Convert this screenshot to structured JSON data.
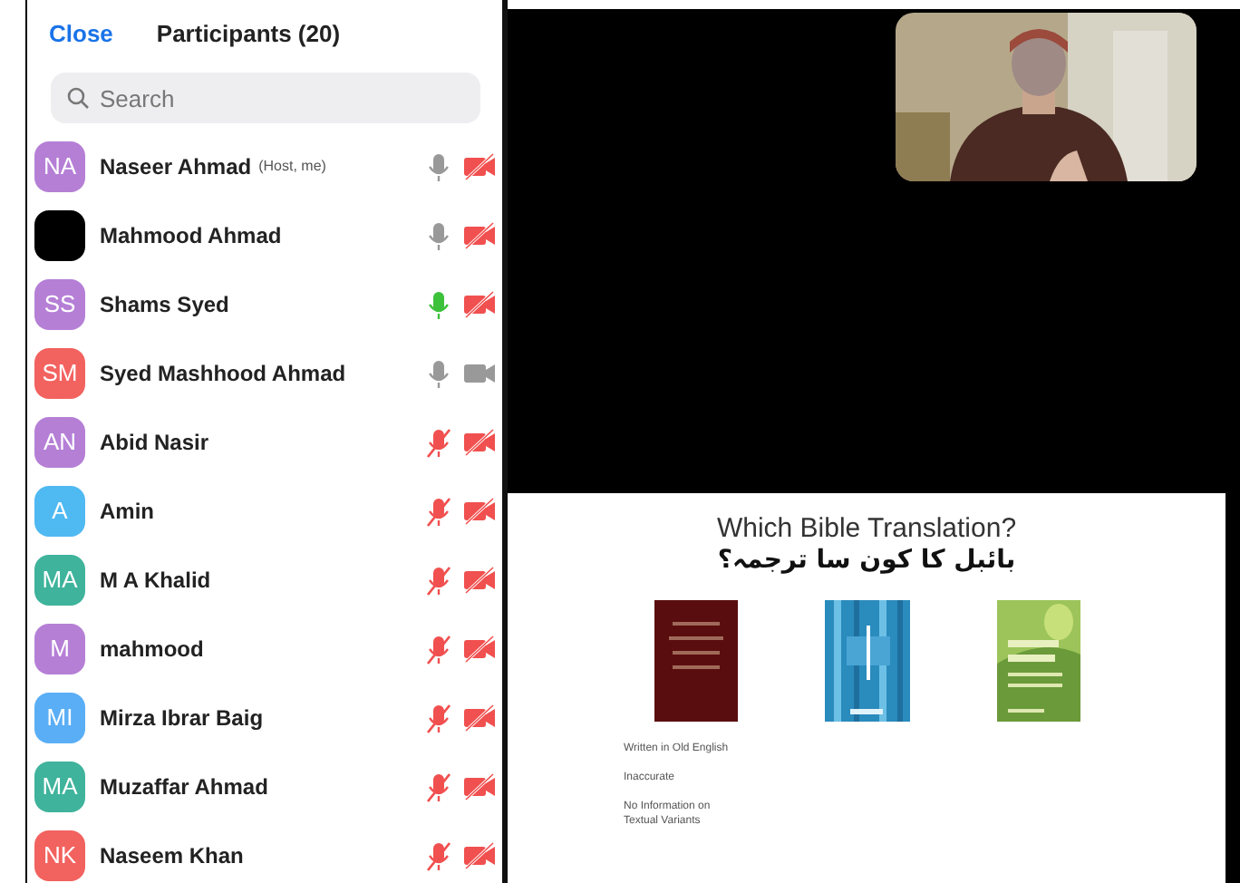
{
  "header": {
    "close": "Close",
    "title": "Participants (20)"
  },
  "search": {
    "placeholder": "Search"
  },
  "participants": [
    {
      "initials": "NA",
      "color": "#b57fd6",
      "name": "Naseer Ahmad",
      "note": "(Host, me)",
      "mic_muted": false,
      "speaking": false,
      "video_off": true
    },
    {
      "color": "#000000",
      "name": "Mahmood Ahmad",
      "mic_muted": false,
      "speaking": false,
      "video_off": true
    },
    {
      "initials": "SS",
      "color": "#b57fd6",
      "name": "Shams Syed",
      "mic_muted": false,
      "speaking": true,
      "video_off": true
    },
    {
      "initials": "SM",
      "color": "#f2625f",
      "name": "Syed Mashhood Ahmad",
      "mic_muted": false,
      "speaking": false,
      "video_off": false
    },
    {
      "initials": "AN",
      "color": "#b57fd6",
      "name": "Abid Nasir",
      "mic_muted": true,
      "speaking": false,
      "video_off": true
    },
    {
      "initials": "A",
      "color": "#4fb9f2",
      "name": "Amin",
      "mic_muted": true,
      "speaking": false,
      "video_off": true
    },
    {
      "initials": "MA",
      "color": "#3fb39c",
      "name": "M A Khalid",
      "mic_muted": true,
      "speaking": false,
      "video_off": true
    },
    {
      "initials": "M",
      "color": "#b57fd6",
      "name": "mahmood",
      "mic_muted": true,
      "speaking": false,
      "video_off": true
    },
    {
      "initials": "MI",
      "color": "#5aaef5",
      "name": "Mirza Ibrar Baig",
      "mic_muted": true,
      "speaking": false,
      "video_off": true
    },
    {
      "initials": "MA",
      "color": "#3fb39c",
      "name": "Muzaffar Ahmad",
      "mic_muted": true,
      "speaking": false,
      "video_off": true
    },
    {
      "initials": "NK",
      "color": "#f2625f",
      "name": "Naseem Khan",
      "mic_muted": true,
      "speaking": false,
      "video_off": true
    }
  ],
  "slide": {
    "title": "Which Bible Translation?",
    "subtitle": "بائبل کا کون سا ترجمہ؟",
    "notes": [
      "Written in Old English",
      "Inaccurate",
      "No Information on Textual Variants"
    ]
  }
}
